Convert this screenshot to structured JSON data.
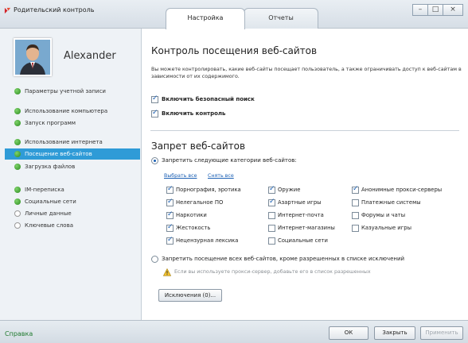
{
  "window": {
    "title": "Родительский контроль",
    "tabs": [
      {
        "label": "Настройка",
        "active": true
      },
      {
        "label": "Отчеты",
        "active": false
      }
    ],
    "controls": {
      "minimize": "–",
      "maximize": "□",
      "close": "×"
    }
  },
  "sidebar": {
    "username": "Alexander",
    "items": [
      {
        "label": "Параметры учетной записи",
        "status": "on"
      },
      {
        "label": "Использование компьютера",
        "status": "on"
      },
      {
        "label": "Запуск программ",
        "status": "on"
      },
      {
        "label": "Использование интернета",
        "status": "on"
      },
      {
        "label": "Посещение веб-сайтов",
        "status": "on",
        "selected": true
      },
      {
        "label": "Загрузка файлов",
        "status": "on"
      },
      {
        "label": "IM-переписка",
        "status": "on"
      },
      {
        "label": "Социальные сети",
        "status": "on"
      },
      {
        "label": "Личные данные",
        "status": "off"
      },
      {
        "label": "Ключевые слова",
        "status": "off"
      }
    ]
  },
  "main": {
    "title": "Контроль посещения веб-сайтов",
    "description": "Вы можете контролировать, какие веб-сайты посещает пользователь, а также ограничивать доступ к веб-сайтам в зависимости от их содержимого.",
    "safe_search_label": "Включить безопасный поиск",
    "safe_search_checked": true,
    "enable_control_label": "Включить контроль",
    "enable_control_checked": true,
    "block_title": "Запрет веб-сайтов",
    "block_categories_label": "Запретить следующие категории веб-сайтов:",
    "select_all": "Выбрать все",
    "clear_all": "Снять все",
    "categories": [
      {
        "label": "Порнография, эротика",
        "checked": true
      },
      {
        "label": "Нелегальное ПО",
        "checked": true
      },
      {
        "label": "Наркотики",
        "checked": true
      },
      {
        "label": "Жестокость",
        "checked": true
      },
      {
        "label": "Нецензурная лексика",
        "checked": true
      },
      {
        "label": "Оружие",
        "checked": true
      },
      {
        "label": "Азартные игры",
        "checked": true
      },
      {
        "label": "Интернет-почта",
        "checked": false
      },
      {
        "label": "Интернет-магазины",
        "checked": false
      },
      {
        "label": "Социальные сети",
        "checked": false
      },
      {
        "label": "Анонимные прокси-серверы",
        "checked": true
      },
      {
        "label": "Платежные системы",
        "checked": false
      },
      {
        "label": "Форумы и чаты",
        "checked": false
      },
      {
        "label": "Казуальные игры",
        "checked": false
      }
    ],
    "block_all_label": "Запретить посещение всех веб-сайтов, кроме разрешенных в списке исключений",
    "proxy_hint": "Если вы используете прокси-сервер, добавьте его в список разрешенных",
    "exceptions_button": "Исключения (0)..."
  },
  "footer": {
    "help": "Справка",
    "ok": "ОК",
    "close": "Закрыть",
    "apply": "Применить"
  },
  "colors": {
    "selected_nav": "#2f9bd7",
    "status_on": "#2a8a1e",
    "link": "#1a5fb4",
    "help_link": "#1f7a2e"
  }
}
